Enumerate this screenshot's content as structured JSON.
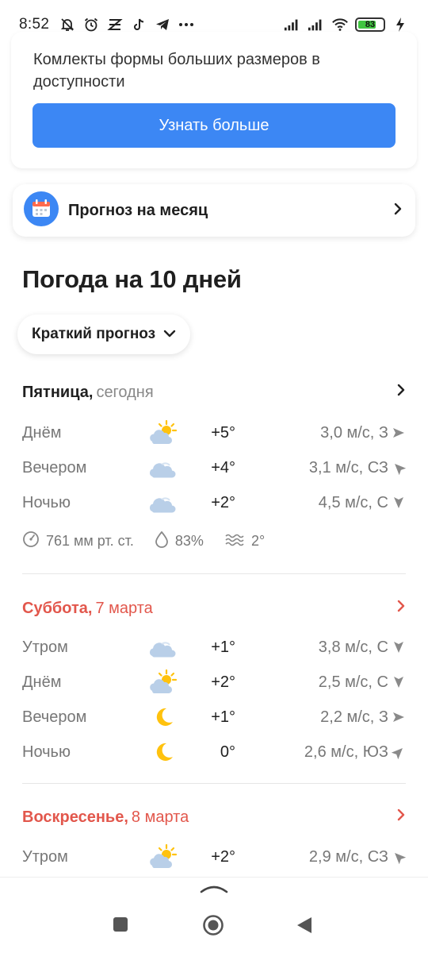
{
  "status_bar": {
    "time": "8:52",
    "battery_level": "83",
    "icons": [
      "bell-muted-icon",
      "alarm-icon",
      "app-icon",
      "tiktok-icon",
      "telegram-icon",
      "more-icon",
      "signal-icon",
      "signal-icon",
      "wifi-icon",
      "battery-icon",
      "charging-icon"
    ]
  },
  "promo": {
    "text": "Комлекты формы больших размеров в доступности",
    "button_label": "Узнать больше",
    "button_color": "#3c87f4"
  },
  "month_forecast": {
    "label": "Прогноз на месяц",
    "icon": "calendar-icon"
  },
  "section_title": "Погода на 10 дней",
  "view_selector": {
    "label": "Краткий прогноз"
  },
  "days": [
    {
      "name": "Пятница,",
      "date": "сегодня",
      "weekend": false,
      "rows": [
        {
          "period": "Днём",
          "icon": "partly-sunny-icon",
          "temp": "+5°",
          "wind": "3,0 м/с, З"
        },
        {
          "period": "Вечером",
          "icon": "cloud-icon",
          "temp": "+4°",
          "wind": "3,1 м/с, СЗ"
        },
        {
          "period": "Ночью",
          "icon": "cloud-icon",
          "temp": "+2°",
          "wind": "4,5 м/с, С"
        }
      ],
      "extras": {
        "pressure": "761 мм рт. ст.",
        "humidity": "83%",
        "water_temp": "2°"
      }
    },
    {
      "name": "Суббота,",
      "date": "7 марта",
      "weekend": true,
      "rows": [
        {
          "period": "Утром",
          "icon": "cloud-icon",
          "temp": "+1°",
          "wind": "3,8 м/с, С"
        },
        {
          "period": "Днём",
          "icon": "partly-sunny-icon",
          "temp": "+2°",
          "wind": "2,5 м/с, С"
        },
        {
          "period": "Вечером",
          "icon": "moon-icon",
          "temp": "+1°",
          "wind": "2,2 м/с, З"
        },
        {
          "period": "Ночью",
          "icon": "moon-icon",
          "temp": "0°",
          "wind": "2,6 м/с, ЮЗ"
        }
      ]
    },
    {
      "name": "Воскресенье,",
      "date": "8 марта",
      "weekend": true,
      "rows": [
        {
          "period": "Утром",
          "icon": "partly-sunny-icon",
          "temp": "+2°",
          "wind": "2,9 м/с, СЗ"
        }
      ]
    }
  ],
  "colors": {
    "weekend": "#e2574c",
    "accent": "#3c87f4"
  }
}
